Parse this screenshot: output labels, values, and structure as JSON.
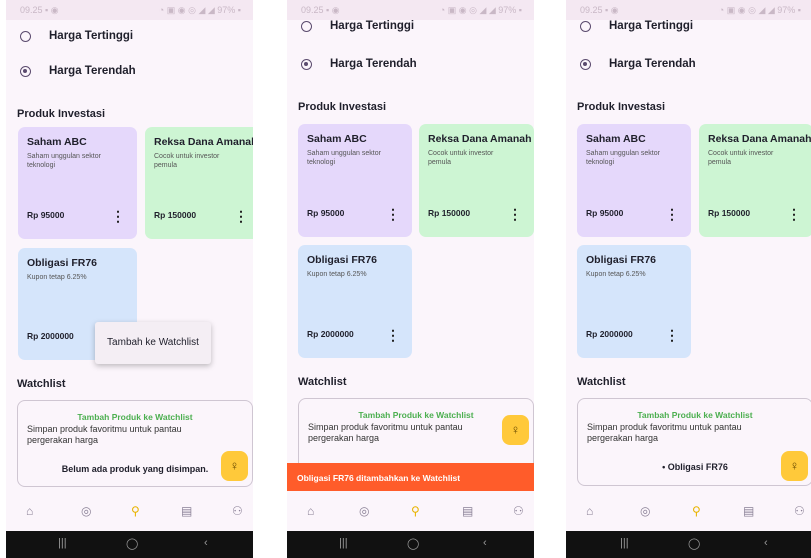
{
  "status_bar": {
    "time": "09.25 ▪ ◉",
    "icons": "◔ ▣ ◉ ◎ ◢ ◢ 97% ▪"
  },
  "filters": {
    "highest": "Harga Tertinggi",
    "lowest": "Harga Terendah"
  },
  "products_title": "Produk Investasi",
  "products": [
    {
      "name": "Saham ABC",
      "desc": "Saham unggulan sektor teknologi",
      "price": "Rp 95000",
      "color": "#e5d8fb"
    },
    {
      "name": "Reksa Dana Amanah",
      "desc": "Cocok untuk investor pemula",
      "price": "Rp 150000",
      "color": "#cdf5d3"
    },
    {
      "name": "Obligasi FR76",
      "desc": "Kupon tetap 6.25%",
      "price": "Rp 2000000",
      "color": "#d5e5fb"
    }
  ],
  "watchlist_title": "Watchlist",
  "watchlist": {
    "heading": "Tambah Produk ke Watchlist",
    "text": "Simpan produk favoritmu untuk pantau pergerakan harga",
    "empty": "Belum ada produk yang disimpan.",
    "item": "• Obligasi FR76"
  },
  "popup_menu": {
    "add": "Tambah ke Watchlist"
  },
  "snackbar": "Obligasi FR76 ditambahkan ke Watchlist",
  "nav_icons": [
    "home-icon",
    "globe-icon",
    "search-icon",
    "book-icon",
    "person-icon"
  ],
  "fab_icon": "lightbulb-icon",
  "system_bar": {
    "recents": "|||",
    "home": "◯",
    "back": "‹"
  },
  "accent_color": "#ffc93a"
}
